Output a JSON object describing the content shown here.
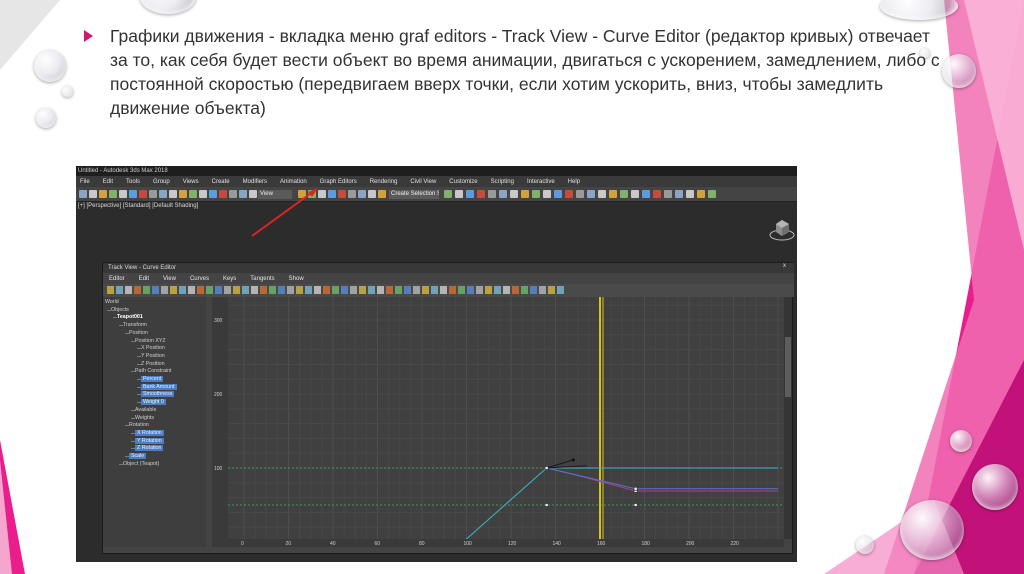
{
  "slide": {
    "bullet_text": "Графики движения - вкладка меню graf editors - Track View - Curve Editor (редактор кривых) отвечает за то, как себя будет вести объект во время анимации, двигаться с ускорением, замедлением, либо с постоянной скоростью (передвигаем вверх точки, если хотим ускорить, вниз, чтобы замедлить движение объекта)",
    "accent_color": "#d6156e"
  },
  "app": {
    "window_title": "Untitled - Autodesk 3ds Max 2018",
    "menu": [
      "File",
      "Edit",
      "Tools",
      "Group",
      "Views",
      "Create",
      "Modifiers",
      "Animation",
      "Graph Editors",
      "Rendering",
      "Civil View",
      "Customize",
      "Scripting",
      "Interactive",
      "Help"
    ],
    "view_select": "View",
    "selection_set": "Create Selection Se",
    "viewport_label": "[+] [Perspective] [Standard] [Default Shading]"
  },
  "curve_editor": {
    "title": "Track View - Curve Editor",
    "close_glyph": "x",
    "menu": [
      "Editor",
      "Edit",
      "View",
      "Curves",
      "Keys",
      "Tangents",
      "Show"
    ],
    "tree": [
      {
        "label": "World",
        "depth": 0
      },
      {
        "label": "Objects",
        "depth": 1
      },
      {
        "label": "Teapot001",
        "depth": 2,
        "highlight": true
      },
      {
        "label": "Transform",
        "depth": 3
      },
      {
        "label": "Position",
        "depth": 4
      },
      {
        "label": "Position XYZ",
        "depth": 5
      },
      {
        "label": "X Position",
        "depth": 6
      },
      {
        "label": "Y Position",
        "depth": 6
      },
      {
        "label": "Z Position",
        "depth": 6
      },
      {
        "label": "Path Constraint",
        "depth": 5
      },
      {
        "label": "Percent",
        "depth": 6,
        "selected": true
      },
      {
        "label": "Bank Amount",
        "depth": 6,
        "selected": true
      },
      {
        "label": "Smoothness",
        "depth": 6,
        "selected": true
      },
      {
        "label": "Weight 0",
        "depth": 6,
        "selected": true
      },
      {
        "label": "Available",
        "depth": 5
      },
      {
        "label": "Weights",
        "depth": 5
      },
      {
        "label": "Rotation",
        "depth": 4
      },
      {
        "label": "X Rotation",
        "depth": 5,
        "selected": true
      },
      {
        "label": "Y Rotation",
        "depth": 5,
        "selected": true
      },
      {
        "label": "Z Rotation",
        "depth": 5,
        "selected": true
      },
      {
        "label": "Scale",
        "depth": 4,
        "selected": true
      },
      {
        "label": "Object (Teapot)",
        "depth": 3
      }
    ],
    "y_labels": [
      "300",
      "200",
      "100"
    ],
    "x_labels": [
      "0",
      "20",
      "40",
      "60",
      "80",
      "100",
      "120",
      "140",
      "160",
      "180",
      "200",
      "220"
    ],
    "time_slider_frame": 160
  }
}
